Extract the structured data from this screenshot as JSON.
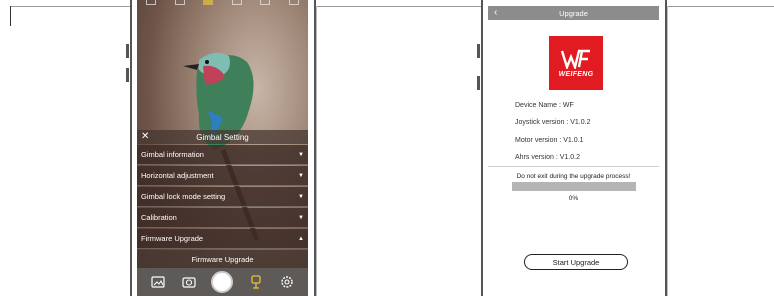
{
  "left_screen": {
    "header_title": "Gimbal Setting",
    "close_glyph": "✕",
    "menu_items": [
      {
        "label": "Gimbal information",
        "caret": "▼"
      },
      {
        "label": "Horizontal adjustment",
        "caret": "▼"
      },
      {
        "label": "Gimbal lock mode setting",
        "caret": "▼"
      },
      {
        "label": "Calibration",
        "caret": "▼"
      },
      {
        "label": "Firmware Upgrade",
        "caret": "▲"
      }
    ],
    "firmware_button": "Firmware Upgrade",
    "bottom_icons": [
      "gallery-icon",
      "camera-switch-icon",
      "shutter-button",
      "gimbal-icon",
      "settings-gear-icon"
    ],
    "accent_color": "#e6c33c"
  },
  "right_screen": {
    "header_title": "Upgrade",
    "back_glyph": "‹",
    "logo_text": "WEIFENG",
    "device_name": "Device Name : WF",
    "joystick_version": "Joystick version : V1.0.2",
    "motor_version": "Motor version : V1.0.1",
    "ahrs_version": "Ahrs version : V1.0.2",
    "warning": "Do not exit during the upgrade process!",
    "progress_percent": 0,
    "progress_label": "0%",
    "start_button": "Start Upgrade",
    "brand_color": "#e11b22"
  }
}
